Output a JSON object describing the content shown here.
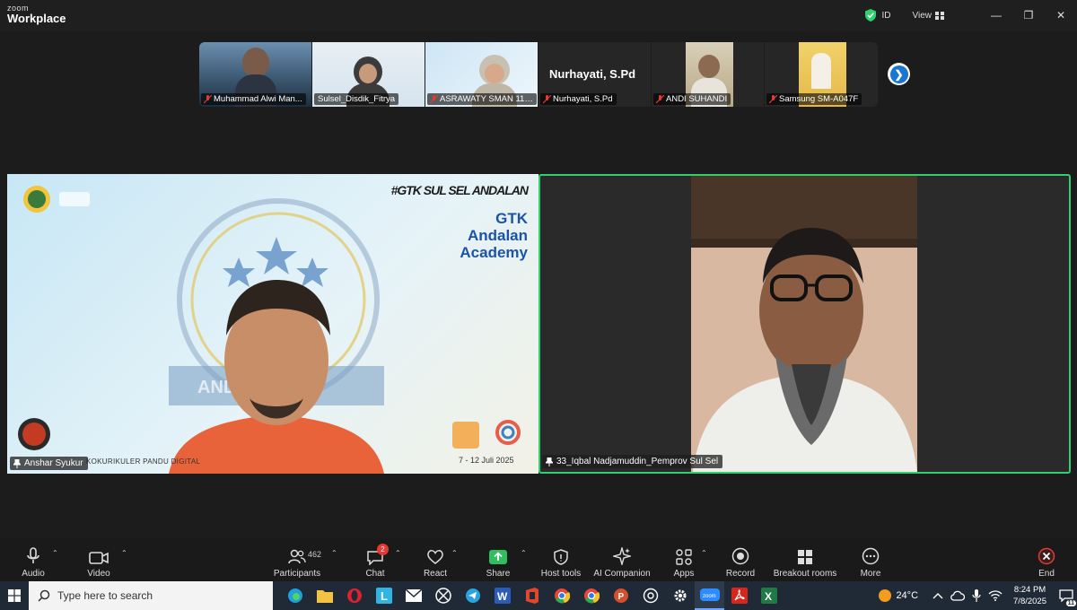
{
  "app": {
    "brand_small": "zoom",
    "brand_big": "Workplace"
  },
  "titlebar": {
    "region": "ID",
    "view_label": "View"
  },
  "thumbnails": [
    {
      "name": "Muhammad Alwi Man..."
    },
    {
      "name": "Sulsel_Disdik_Fitrya"
    },
    {
      "name": "ASRAWATY SMAN 11 ..."
    },
    {
      "name": "Nurhayati, S.Pd",
      "big_name": "Nurhayati, S.Pd"
    },
    {
      "name": "ANDI SUHANDI"
    },
    {
      "name": "Samsung SM-A047F"
    }
  ],
  "main_left": {
    "name": "Anshar Syukur",
    "hashtag": "#GTK SUL SEL ANDALAN",
    "title_lines": [
      "GTK",
      "Andalan",
      "Academy"
    ],
    "event": "KOKURIKULER PANDU DIGITAL",
    "date": "7 - 12 Juli 2025"
  },
  "main_right": {
    "name": "33_Iqbal Nadjamuddin_Pemprov Sul Sel"
  },
  "toolbar": {
    "audio": "Audio",
    "video": "Video",
    "participants": "Participants",
    "participants_count": "462",
    "chat": "Chat",
    "chat_badge": "2",
    "react": "React",
    "share": "Share",
    "host_tools": "Host tools",
    "ai_companion": "AI Companion",
    "apps": "Apps",
    "record": "Record",
    "breakout": "Breakout rooms",
    "more": "More",
    "end": "End"
  },
  "taskbar": {
    "search_placeholder": "Type here to search",
    "temperature": "24°C",
    "time": "8:24 PM",
    "date": "7/8/2025",
    "notif_count": "11"
  },
  "colors": {
    "active_speaker": "#2fd16f",
    "zoom_blue": "#1976d2",
    "end_red": "#e53935"
  }
}
